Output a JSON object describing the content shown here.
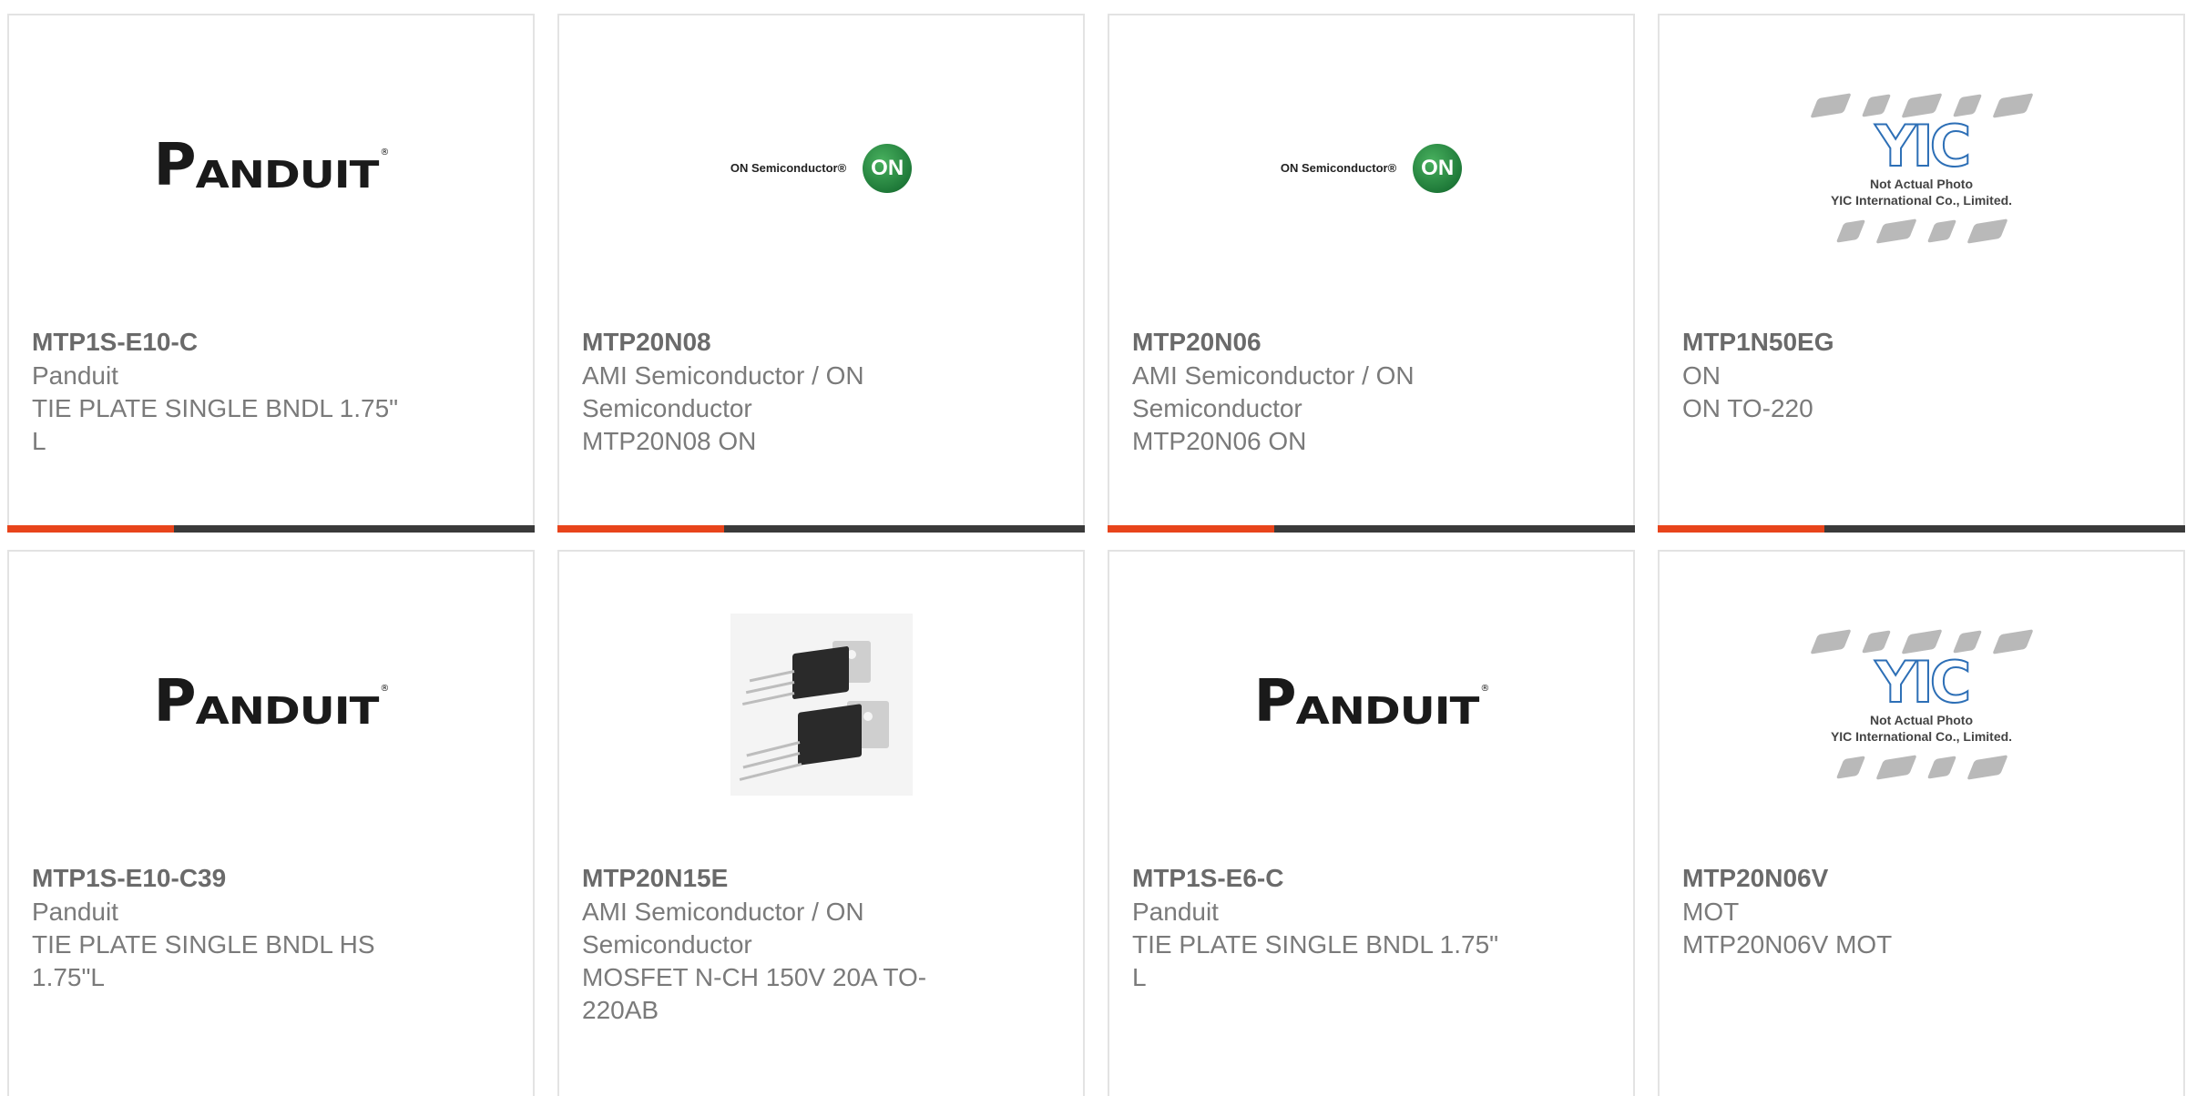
{
  "colors": {
    "accent": "#e8441b",
    "bar": "#3a3a3a",
    "border": "#e3e3e3",
    "text": "#7a7a7a"
  },
  "cards": [
    {
      "part_number": "MTP1S-E10-C",
      "manufacturer": "Panduit",
      "description": "TIE PLATE SINGLE BNDL 1.75\" L",
      "image": "panduit-logo"
    },
    {
      "part_number": "MTP20N08",
      "manufacturer": "AMI Semiconductor / ON Semiconductor",
      "description": "MTP20N08 ON",
      "image": "on-semiconductor-logo"
    },
    {
      "part_number": "MTP20N06",
      "manufacturer": "AMI Semiconductor / ON Semiconductor",
      "description": "MTP20N06 ON",
      "image": "on-semiconductor-logo"
    },
    {
      "part_number": "MTP1N50EG",
      "manufacturer": "ON",
      "description": "ON TO-220",
      "image": "yic-placeholder"
    },
    {
      "part_number": "MTP1S-E10-C39",
      "manufacturer": "Panduit",
      "description": "TIE PLATE SINGLE BNDL HS 1.75\"L",
      "image": "panduit-logo"
    },
    {
      "part_number": "MTP20N15E",
      "manufacturer": "AMI Semiconductor / ON Semiconductor",
      "description": "MOSFET N-CH 150V 20A TO-220AB",
      "image": "transistor-photo"
    },
    {
      "part_number": "MTP1S-E6-C",
      "manufacturer": "Panduit",
      "description": "TIE PLATE SINGLE BNDL 1.75\" L",
      "image": "panduit-logo"
    },
    {
      "part_number": "MTP20N06V",
      "manufacturer": "MOT",
      "description": "MTP20N06V MOT",
      "image": "yic-placeholder"
    }
  ],
  "logos": {
    "panduit": "PANDUIT",
    "on_semi_text": "ON Semiconductor®",
    "on_badge": "ON",
    "yic_mark": "YIC",
    "yic_caption_1": "Not Actual Photo",
    "yic_caption_2": "YIC International Co., Limited."
  }
}
